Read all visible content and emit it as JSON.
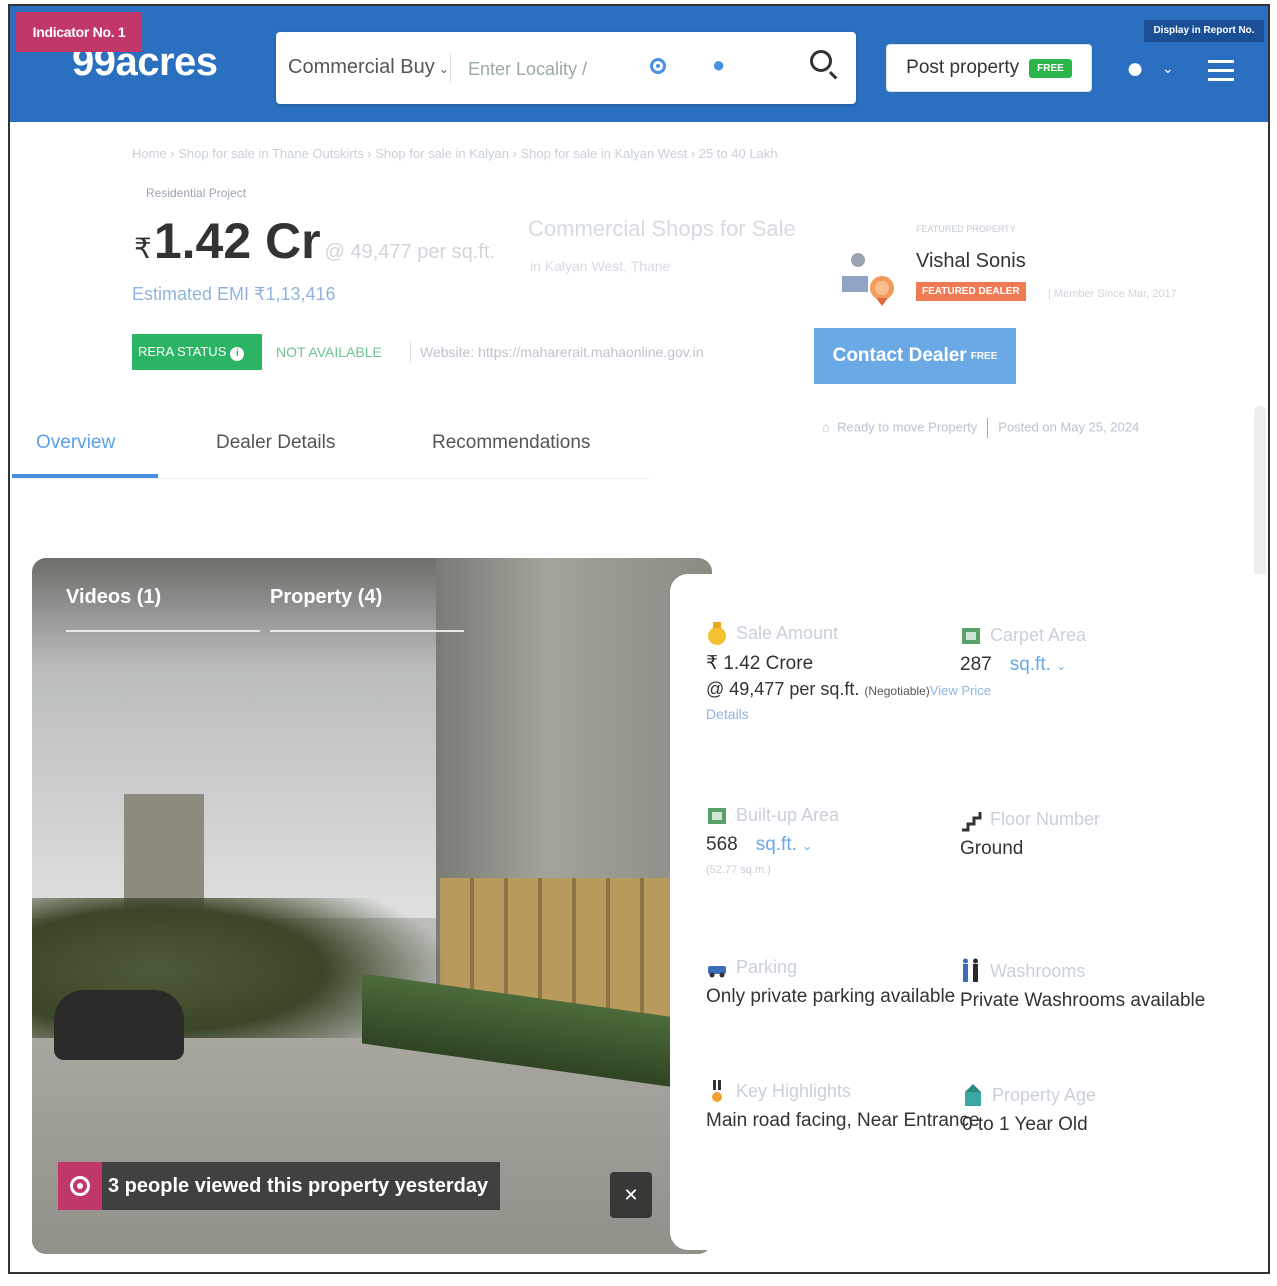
{
  "header": {
    "indicator": "Indicator No. 1",
    "display_report": "Display in Report No. ",
    "logo": "99acres",
    "search_category": "Commercial Buy",
    "search_placeholder": "Enter Locality /",
    "post_property": "Post property",
    "free_tag": "FREE",
    "brand_color": "#2b6fc0"
  },
  "breadcrumb": "Home › Shop for sale in Thane Outskirts › Shop for sale in Kalyan › Shop for sale in Kalyan West › 25 to 40 Lakh",
  "listing": {
    "project_type": "Residential Project",
    "currency_symbol": "₹",
    "price": "1.42 Cr",
    "price_per_sqft": "@ 49,477 per sq.ft.",
    "emi": "Estimated EMI ₹1,13,416",
    "title": "Commercial Shops for Sale",
    "location": "in Kalyan West, Thane"
  },
  "rera": {
    "status_label": "RERA STATUS",
    "info_icon": "i",
    "status_value": "NOT AVAILABLE",
    "website": "Website: https://maharerait.mahaonline.gov.in"
  },
  "dealer": {
    "label": "FEATURED PROPERTY",
    "name": "Vishal Sonis",
    "badge": "FEATURED DEALER",
    "member_since": "| Member Since Mar, 2017",
    "contact_button": "Contact Dealer",
    "contact_free": "FREE",
    "ready_status": "Ready to move Property",
    "posted": "Posted on May 25, 2024"
  },
  "tabs": [
    "Overview",
    "Dealer Details",
    "Recommendations"
  ],
  "media": {
    "tab_videos": "Videos (1)",
    "tab_property": "Property (4)",
    "viewed_text": "3 people viewed this property yesterday"
  },
  "details": {
    "sale_amount": {
      "label": "Sale Amount",
      "value": "₹ 1.42 Crore",
      "per_sqft": "@ 49,477 per sq.ft.",
      "negotiable": "(Negotiable)",
      "view_price": "View Price",
      "details_link": "Details"
    },
    "carpet_area": {
      "label": "Carpet Area",
      "value": "287",
      "unit": "sq.ft."
    },
    "built_up_area": {
      "label": "Built-up Area",
      "value": "568",
      "unit": "sq.ft.",
      "sub": "(52.77 sq.m.)"
    },
    "floor_number": {
      "label": "Floor Number",
      "value": "Ground"
    },
    "parking": {
      "label": "Parking",
      "value": "Only private parking available"
    },
    "washrooms": {
      "label": "Washrooms",
      "value": "Private Washrooms available"
    },
    "key_highlights": {
      "label": "Key Highlights",
      "value": "Main road facing, Near Entrance"
    },
    "property_age": {
      "label": "Property Age",
      "value": "0 to 1 Year Old"
    }
  }
}
